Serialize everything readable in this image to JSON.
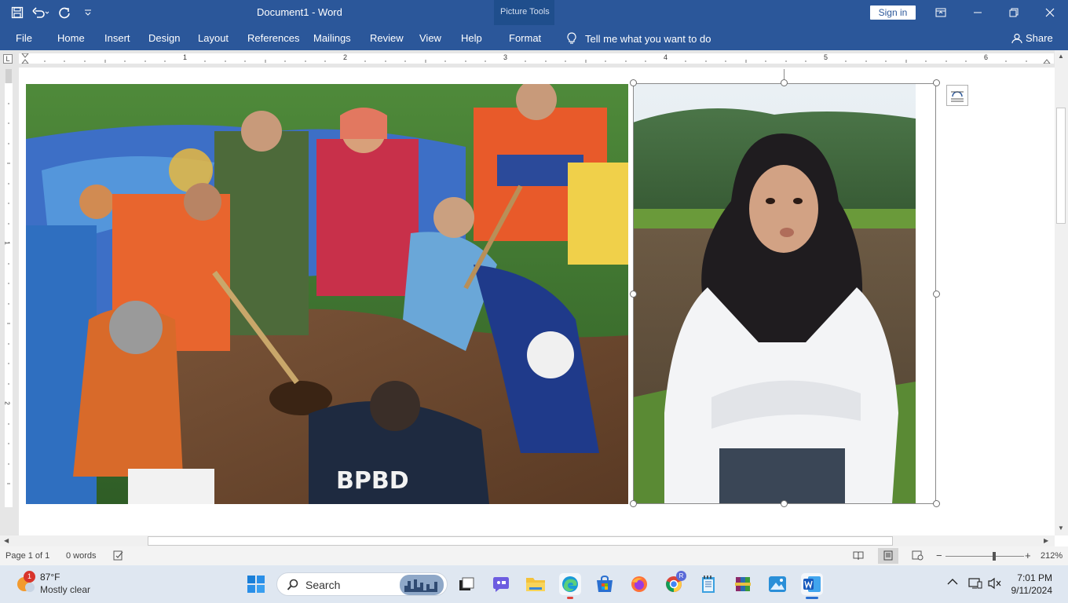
{
  "titlebar": {
    "doc_title": "Document1  -  Word",
    "context_tools": "Picture Tools",
    "signin": "Sign in"
  },
  "ribbon": {
    "tabs": [
      "File",
      "Home",
      "Insert",
      "Design",
      "Layout",
      "References",
      "Mailings",
      "Review",
      "View",
      "Help",
      "Format"
    ],
    "active_tab": "Format",
    "tell_me": "Tell me what you want to do",
    "share": "Share"
  },
  "ruler": {
    "corner": "L",
    "numbers": [
      "1",
      "2",
      "3",
      "4",
      "5",
      "6"
    ],
    "vertical_numbers": [
      "1",
      "2"
    ]
  },
  "statusbar": {
    "page": "Page 1 of 1",
    "words": "0 words",
    "zoom": "212%"
  },
  "taskbar": {
    "weather_badge": "1",
    "temperature": "87°F",
    "condition": "Mostly clear",
    "search_label": "Search",
    "chrome_badge": "R",
    "time": "7:01 PM",
    "date": "9/11/2024"
  },
  "colors": {
    "word_blue": "#2b579a",
    "context_tab": "#1f4e8c",
    "taskbar": "#dfe7f1"
  }
}
